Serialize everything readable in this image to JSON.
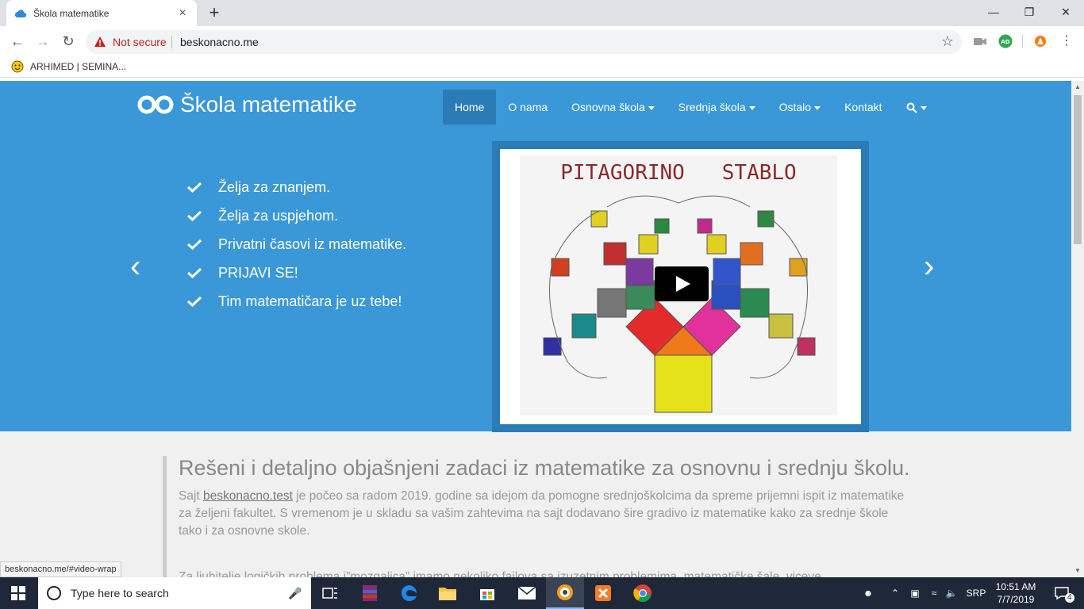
{
  "browser": {
    "tab_title": "Škola matematike",
    "security_label": "Not secure",
    "url": "beskonacno.me",
    "bookmark_label": "ARHIMED | SEMINA...",
    "extension_badge": "AD"
  },
  "site": {
    "brand": "Škola matematike",
    "nav": [
      {
        "label": "Home",
        "active": true
      },
      {
        "label": "O nama"
      },
      {
        "label": "Osnovna škola",
        "dropdown": true
      },
      {
        "label": "Srednja škola",
        "dropdown": true
      },
      {
        "label": "Ostalo",
        "dropdown": true
      },
      {
        "label": "Kontakt"
      }
    ],
    "carousel": {
      "prev_arrow": "‹",
      "next_arrow": "›",
      "items": [
        "Želja za znanjem.",
        "Želja za uspjehom.",
        "Privatni časovi iz matematike.",
        "PRIJAVI SE!",
        "Tim matematičara je uz tebe!"
      ],
      "video_title": "PITAGORINO   STABLO"
    },
    "article": {
      "heading": "Rešeni i detaljno objašnjeni zadaci iz matematike za osnovnu i srednju školu.",
      "p1_prefix": "Sajt ",
      "p1_link": "beskonacno.test",
      "p1_rest": " je počeo sa radom 2019. godine sa idejom da pomogne srednjoškolcima da spreme prijemni ispit iz matematike za željeni fakultet. S vremenom je u skladu sa vašim zahtevima na sajt dodavano šire gradivo iz matematike kako za srednje škole tako i za osnovne skole.",
      "p2": "Za ljubitelje logičkih problema i”mozgalica” imamo nekoliko fajlova sa izuzetnim problemima, matematičke šale, viceve..."
    },
    "status_link": "beskonacno.me/#video-wrap"
  },
  "taskbar": {
    "search_placeholder": "Type here to search",
    "lang": "SRP",
    "time": "10:51 AM",
    "date": "7/7/2019",
    "notification_count": "4"
  },
  "colors": {
    "hero": "#3a97d8",
    "nav_active": "#2a7bb6",
    "taskbar": "#1f2838"
  }
}
